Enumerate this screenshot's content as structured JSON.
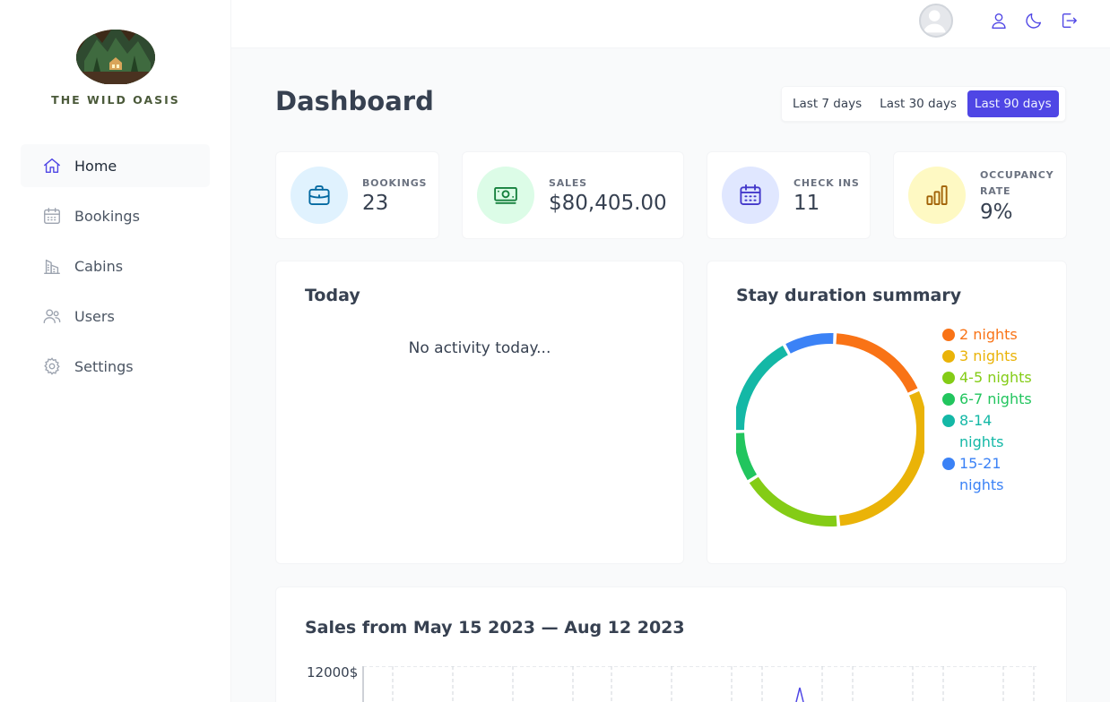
{
  "app": {
    "name": "THE WILD OASIS"
  },
  "sidebar": {
    "items": [
      {
        "label": "Home",
        "icon": "home-icon",
        "active": true
      },
      {
        "label": "Bookings",
        "icon": "calendar-icon",
        "active": false
      },
      {
        "label": "Cabins",
        "icon": "cabins-icon",
        "active": false
      },
      {
        "label": "Users",
        "icon": "users-icon",
        "active": false
      },
      {
        "label": "Settings",
        "icon": "gear-icon",
        "active": false
      }
    ]
  },
  "header": {
    "icons": [
      "user-icon",
      "moon-icon",
      "logout-icon"
    ]
  },
  "page": {
    "title": "Dashboard"
  },
  "filter": {
    "options": [
      "Last 7 days",
      "Last 30 days",
      "Last 90 days"
    ],
    "active": "Last 90 days"
  },
  "stats": [
    {
      "title": "Bookings",
      "value": "23",
      "icon": "briefcase-icon",
      "bg": "#e0f2fe",
      "color": "#0369a1"
    },
    {
      "title": "Sales",
      "value": "$80,405.00",
      "icon": "banknotes-icon",
      "bg": "#dcfce7",
      "color": "#15803d"
    },
    {
      "title": "Check ins",
      "value": "11",
      "icon": "calendar-days-icon",
      "bg": "#e0e7ff",
      "color": "#4338ca"
    },
    {
      "title": "Occupancy rate",
      "value": "9%",
      "icon": "chart-bar-icon",
      "bg": "#fef9c3",
      "color": "#a16207"
    }
  ],
  "today": {
    "title": "Today",
    "empty_text": "No activity today..."
  },
  "duration": {
    "title": "Stay duration summary",
    "chart_data": {
      "type": "pie",
      "labels": [
        "2 nights",
        "3 nights",
        "4-5 nights",
        "6-7 nights",
        "8-14 nights",
        "15-21 nights"
      ],
      "values": [
        4,
        7,
        4,
        2,
        4,
        2
      ],
      "colors": [
        "#f97316",
        "#eab308",
        "#84cc16",
        "#22c55e",
        "#14b8a6",
        "#3b82f6"
      ]
    }
  },
  "sales": {
    "title": "Sales from May 15 2023 — Aug 12 2023",
    "y_top_label": "12000$"
  }
}
